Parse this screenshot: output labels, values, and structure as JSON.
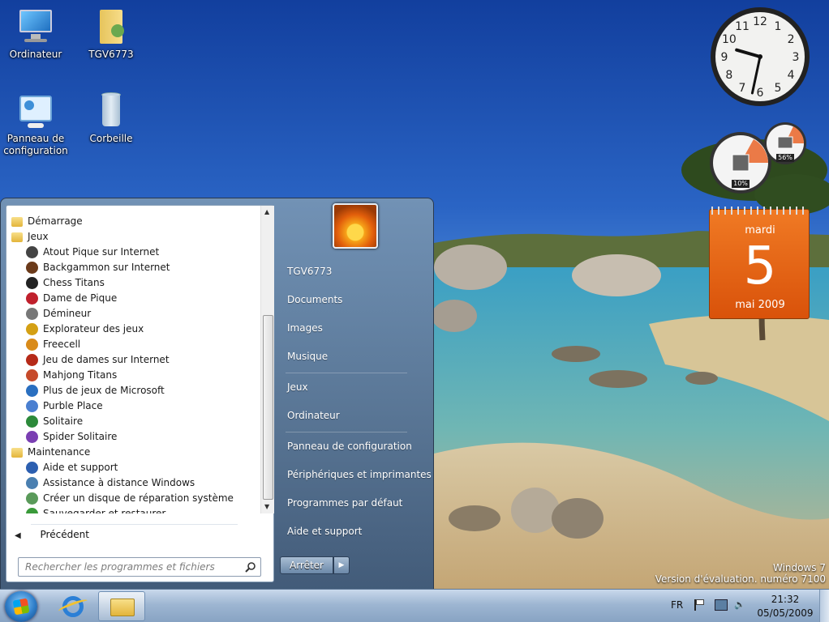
{
  "desktop": {
    "icons": [
      {
        "label": "Ordinateur",
        "icon": "computer-icon"
      },
      {
        "label": "TGV6773",
        "icon": "user-folder-icon"
      },
      {
        "label": "Panneau de configuration",
        "line1": "Panneau de",
        "line2": "configuration",
        "icon": "control-panel-icon"
      },
      {
        "label": "Corbeille",
        "icon": "recycle-bin-icon"
      }
    ],
    "watermark": {
      "line1": "Windows 7",
      "line2": "Version d'évaluation. numéro 7100"
    }
  },
  "gadgets": {
    "clock": {
      "numbers": [
        "12",
        "1",
        "2",
        "3",
        "4",
        "5",
        "6",
        "7",
        "8",
        "9",
        "10",
        "11"
      ],
      "time_hour": 9,
      "time_minute": 32
    },
    "cpu_meter": {
      "cpu": "10%",
      "memory": "56%"
    },
    "calendar": {
      "weekday": "mardi",
      "day": "5",
      "month_year": "mai 2009"
    }
  },
  "start_menu": {
    "programs": [
      {
        "label": "Démarrage",
        "level": 0,
        "icon": "folder-icon"
      },
      {
        "label": "Jeux",
        "level": 0,
        "icon": "folder-icon"
      },
      {
        "label": "Atout Pique sur Internet",
        "level": 1,
        "icon": "spade-game-icon"
      },
      {
        "label": "Backgammon sur Internet",
        "level": 1,
        "icon": "backgammon-icon"
      },
      {
        "label": "Chess Titans",
        "level": 1,
        "icon": "chess-icon"
      },
      {
        "label": "Dame de Pique",
        "level": 1,
        "icon": "hearts-icon"
      },
      {
        "label": "Démineur",
        "level": 1,
        "icon": "mine-icon"
      },
      {
        "label": "Explorateur des jeux",
        "level": 1,
        "icon": "games-explorer-icon"
      },
      {
        "label": "Freecell",
        "level": 1,
        "icon": "freecell-icon"
      },
      {
        "label": "Jeu de dames sur Internet",
        "level": 1,
        "icon": "checkers-icon"
      },
      {
        "label": "Mahjong Titans",
        "level": 1,
        "icon": "mahjong-icon"
      },
      {
        "label": "Plus de jeux de Microsoft",
        "level": 1,
        "icon": "more-games-icon"
      },
      {
        "label": "Purble Place",
        "level": 1,
        "icon": "purble-icon"
      },
      {
        "label": "Solitaire",
        "level": 1,
        "icon": "solitaire-icon"
      },
      {
        "label": "Spider Solitaire",
        "level": 1,
        "icon": "spider-icon"
      },
      {
        "label": "Maintenance",
        "level": 0,
        "icon": "folder-icon"
      },
      {
        "label": "Aide et support",
        "level": 1,
        "icon": "help-icon"
      },
      {
        "label": "Assistance à distance Windows",
        "level": 1,
        "icon": "remote-assist-icon"
      },
      {
        "label": "Créer un disque de réparation système",
        "level": 1,
        "icon": "repair-disc-icon"
      },
      {
        "label": "Sauvegarder et restaurer",
        "level": 1,
        "icon": "backup-icon"
      }
    ],
    "back_label": "Précédent",
    "search_placeholder": "Rechercher les programmes et fichiers",
    "right_items": [
      {
        "label": "TGV6773"
      },
      {
        "label": "Documents"
      },
      {
        "label": "Images"
      },
      {
        "label": "Musique"
      },
      {
        "label": "Jeux"
      },
      {
        "label": "Ordinateur"
      },
      {
        "label": "Panneau de configuration"
      },
      {
        "label": "Périphériques et imprimantes"
      },
      {
        "label": "Programmes par défaut"
      },
      {
        "label": "Aide et support"
      }
    ],
    "shutdown_label": "Arrêter"
  },
  "taskbar": {
    "language": "FR",
    "time": "21:32",
    "date": "05/05/2009",
    "pinned": [
      "internet-explorer-icon",
      "windows-explorer-icon"
    ]
  },
  "colors": {
    "calendar": "#e8620f",
    "accent": "#2f7ec9"
  }
}
